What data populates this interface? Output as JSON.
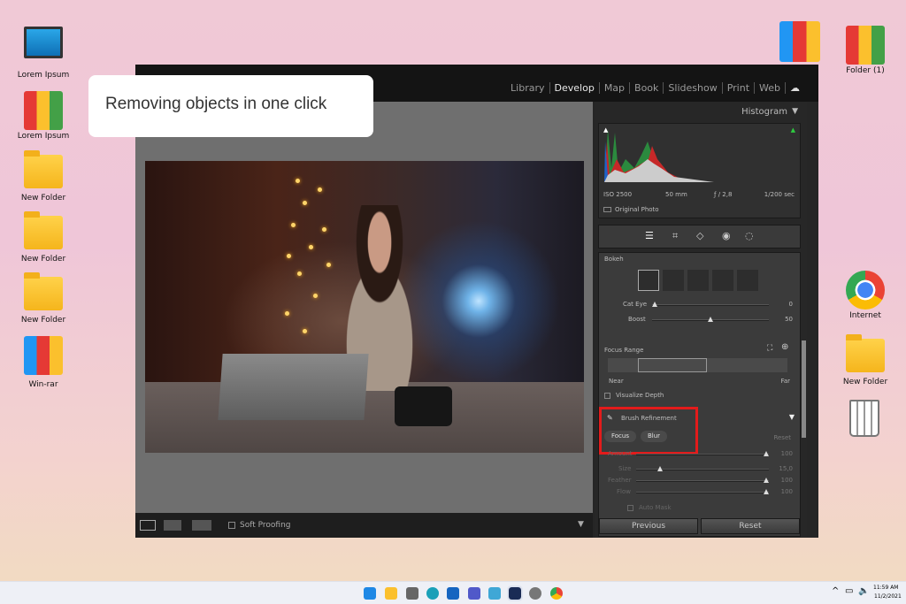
{
  "desktop": {
    "left_icons": [
      {
        "label": "Lorem Ipsum",
        "icon": "computer-icon"
      },
      {
        "label": "Lorem Ipsum",
        "icon": "binders-icon"
      },
      {
        "label": "New Folder",
        "icon": "folder-icon"
      },
      {
        "label": "New Folder",
        "icon": "folder-icon"
      },
      {
        "label": "New Folder",
        "icon": "folder-icon"
      },
      {
        "label": "Win-rar",
        "icon": "winrar-icon"
      }
    ],
    "right_icons": [
      {
        "label": "Folder (1)",
        "icon": "binders-icon"
      },
      {
        "label": "Internet",
        "icon": "chrome-icon"
      },
      {
        "label": "New Folder",
        "icon": "folder-icon"
      }
    ]
  },
  "tooltip": "Removing objects in one click",
  "app": {
    "modules": [
      "Library",
      "Develop",
      "Map",
      "Book",
      "Slideshow",
      "Print",
      "Web"
    ],
    "active_module": "Develop",
    "toolbar": {
      "soft_proofing": "Soft Proofing"
    },
    "histogram": {
      "title": "Histogram",
      "iso": "ISO 2500",
      "focal": "50 mm",
      "aperture": "ƒ / 2,8",
      "shutter": "1/200 sec",
      "original_photo": "Original Photo"
    },
    "lens_blur": {
      "bokeh_label": "Bokeh",
      "cat_eye_label": "Cat Eye",
      "cat_eye_value": "0",
      "cat_eye_fraction": 0,
      "boost_label": "Boost",
      "boost_value": "50",
      "boost_fraction": 0.5,
      "focus_range_label": "Focus Range",
      "near": "Near",
      "far": "Far",
      "visualize_depth": "Visualize Depth",
      "brush_refinement": "Brush Refinement",
      "focus": "Focus",
      "blur": "Blur",
      "reset": "Reset",
      "amount_label": "Amount",
      "amount_value": "100",
      "size_label": "Size",
      "size_value": "15,0",
      "feather_label": "Feather",
      "feather_value": "100",
      "flow_label": "Flow",
      "flow_value": "100",
      "auto_mask": "Auto Mask"
    },
    "previous": "Previous",
    "reset_button": "Reset"
  },
  "taskbar": {
    "time": "11:59 AM",
    "date": "11/2/2021"
  }
}
